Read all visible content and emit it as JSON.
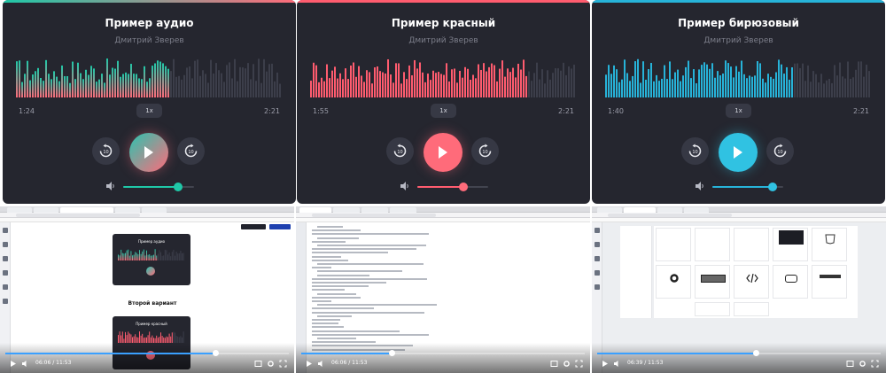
{
  "players": [
    {
      "title": "Пример аудио",
      "artist": "Дмитрий Зверев",
      "current_time": "1:24",
      "total_time": "2:21",
      "speed": "1x",
      "progress": 0.58,
      "volume": 0.77,
      "theme": "teal-pink-gradient",
      "colors": {
        "played_top": "#1fc8a8",
        "played_bottom": "#ff6b7a",
        "unplayed": "#3c3e4a",
        "button_from": "#2ac4b0",
        "button_to": "#ff6b7a"
      }
    },
    {
      "title": "Пример красный",
      "artist": "Дмитрий Зверев",
      "current_time": "1:55",
      "total_time": "2:21",
      "speed": "1x",
      "progress": 0.82,
      "volume": 0.65,
      "theme": "red",
      "colors": {
        "played_top": "#ff5c6f",
        "played_bottom": "#ff5c6f",
        "unplayed": "#3c3e4a",
        "button_from": "#ff6b7a",
        "button_to": "#ff6b7a"
      }
    },
    {
      "title": "Пример бирюзовый",
      "artist": "Дмитрий Зверев",
      "current_time": "1:40",
      "total_time": "2:21",
      "speed": "1x",
      "progress": 0.71,
      "volume": 0.85,
      "theme": "turquoise",
      "colors": {
        "played_top": "#27b3d9",
        "played_bottom": "#27b3d9",
        "unplayed": "#3c3e4a",
        "button_from": "#30c2e2",
        "button_to": "#30c2e2"
      }
    }
  ],
  "screenshots": [
    {
      "page_heading": "Второй вариант",
      "video_time": "06:06 / 11:53",
      "video_progress": 0.74,
      "player_titles": [
        "Пример аудио",
        "Пример красный"
      ]
    },
    {
      "video_time": "06:06 / 11:53",
      "video_progress": 0.32
    },
    {
      "video_time": "06:39 / 11:53",
      "video_progress": 0.56
    }
  ],
  "icons": {
    "rewind": "rewind-10-icon",
    "forward": "forward-10-icon",
    "play": "play-icon",
    "volume": "volume-icon"
  }
}
